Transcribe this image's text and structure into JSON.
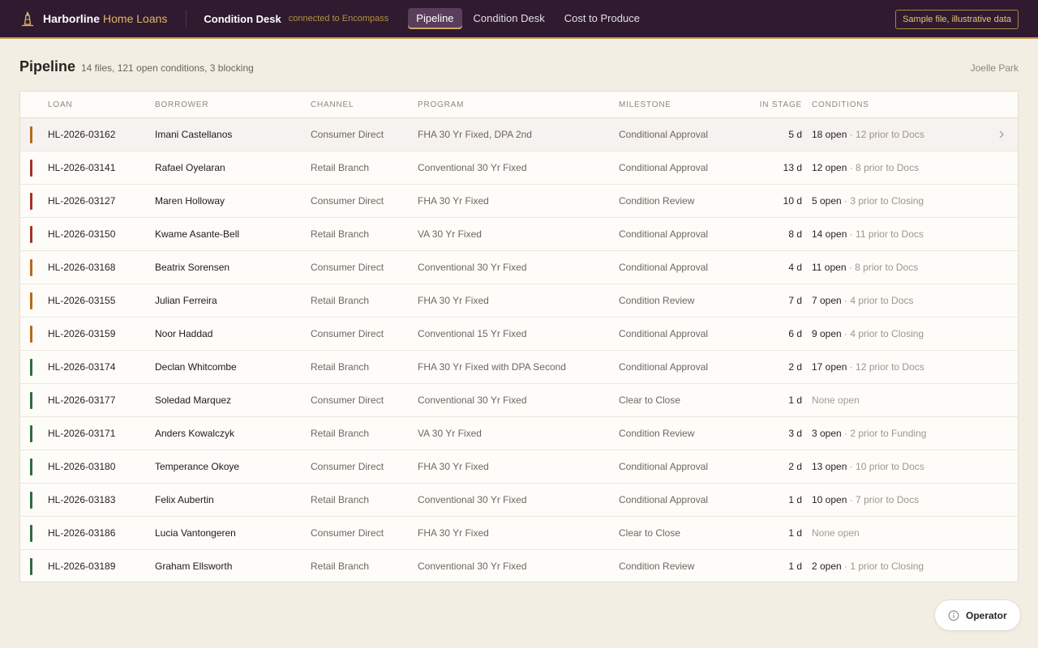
{
  "brand": {
    "name": "Harborline",
    "sub": "Home Loans",
    "icon": "lighthouse-icon"
  },
  "app": {
    "title": "Condition Desk",
    "status": "connected to Encompass"
  },
  "nav": {
    "tabs": [
      {
        "label": "Pipeline",
        "active": true
      },
      {
        "label": "Condition Desk",
        "active": false
      },
      {
        "label": "Cost to Produce",
        "active": false
      }
    ]
  },
  "badge": "Sample file, illustrative data",
  "page": {
    "title": "Pipeline",
    "summary": "14 files, 121 open conditions, 3 blocking",
    "user": "Joelle Park"
  },
  "table": {
    "headers": {
      "loan": "LOAN",
      "borrower": "BORROWER",
      "channel": "CHANNEL",
      "program": "PROGRAM",
      "milestone": "MILESTONE",
      "stage": "IN STAGE",
      "conditions": "CONDITIONS"
    },
    "rows": [
      {
        "status": "amber",
        "loan": "HL-2026-03162",
        "borrower": "Imani Castellanos",
        "channel": "Consumer Direct",
        "program": "FHA 30 Yr Fixed, DPA 2nd",
        "milestone": "Conditional Approval",
        "stage": "5 d",
        "cond_main": "18 open",
        "cond_sub": " · 12 prior to Docs"
      },
      {
        "status": "red",
        "loan": "HL-2026-03141",
        "borrower": "Rafael Oyelaran",
        "channel": "Retail Branch",
        "program": "Conventional 30 Yr Fixed",
        "milestone": "Conditional Approval",
        "stage": "13 d",
        "cond_main": "12 open",
        "cond_sub": " · 8 prior to Docs"
      },
      {
        "status": "red",
        "loan": "HL-2026-03127",
        "borrower": "Maren Holloway",
        "channel": "Consumer Direct",
        "program": "FHA 30 Yr Fixed",
        "milestone": "Condition Review",
        "stage": "10 d",
        "cond_main": "5 open",
        "cond_sub": " · 3 prior to Closing"
      },
      {
        "status": "red",
        "loan": "HL-2026-03150",
        "borrower": "Kwame Asante-Bell",
        "channel": "Retail Branch",
        "program": "VA 30 Yr Fixed",
        "milestone": "Conditional Approval",
        "stage": "8 d",
        "cond_main": "14 open",
        "cond_sub": " · 11 prior to Docs"
      },
      {
        "status": "amber",
        "loan": "HL-2026-03168",
        "borrower": "Beatrix Sorensen",
        "channel": "Consumer Direct",
        "program": "Conventional 30 Yr Fixed",
        "milestone": "Conditional Approval",
        "stage": "4 d",
        "cond_main": "11 open",
        "cond_sub": " · 8 prior to Docs"
      },
      {
        "status": "amber",
        "loan": "HL-2026-03155",
        "borrower": "Julian Ferreira",
        "channel": "Retail Branch",
        "program": "FHA 30 Yr Fixed",
        "milestone": "Condition Review",
        "stage": "7 d",
        "cond_main": "7 open",
        "cond_sub": " · 4 prior to Docs"
      },
      {
        "status": "amber",
        "loan": "HL-2026-03159",
        "borrower": "Noor Haddad",
        "channel": "Consumer Direct",
        "program": "Conventional 15 Yr Fixed",
        "milestone": "Conditional Approval",
        "stage": "6 d",
        "cond_main": "9 open",
        "cond_sub": " · 4 prior to Closing"
      },
      {
        "status": "green",
        "loan": "HL-2026-03174",
        "borrower": "Declan Whitcombe",
        "channel": "Retail Branch",
        "program": "FHA 30 Yr Fixed with DPA Second",
        "milestone": "Conditional Approval",
        "stage": "2 d",
        "cond_main": "17 open",
        "cond_sub": " · 12 prior to Docs"
      },
      {
        "status": "green",
        "loan": "HL-2026-03177",
        "borrower": "Soledad Marquez",
        "channel": "Consumer Direct",
        "program": "Conventional 30 Yr Fixed",
        "milestone": "Clear to Close",
        "stage": "1 d",
        "cond_main": "",
        "cond_sub": "",
        "cond_none": "None open"
      },
      {
        "status": "green",
        "loan": "HL-2026-03171",
        "borrower": "Anders Kowalczyk",
        "channel": "Retail Branch",
        "program": "VA 30 Yr Fixed",
        "milestone": "Condition Review",
        "stage": "3 d",
        "cond_main": "3 open",
        "cond_sub": " · 2 prior to Funding"
      },
      {
        "status": "green",
        "loan": "HL-2026-03180",
        "borrower": "Temperance Okoye",
        "channel": "Consumer Direct",
        "program": "FHA 30 Yr Fixed",
        "milestone": "Conditional Approval",
        "stage": "2 d",
        "cond_main": "13 open",
        "cond_sub": " · 10 prior to Docs"
      },
      {
        "status": "green",
        "loan": "HL-2026-03183",
        "borrower": "Felix Aubertin",
        "channel": "Retail Branch",
        "program": "Conventional 30 Yr Fixed",
        "milestone": "Conditional Approval",
        "stage": "1 d",
        "cond_main": "10 open",
        "cond_sub": " · 7 prior to Docs"
      },
      {
        "status": "green",
        "loan": "HL-2026-03186",
        "borrower": "Lucia Vantongeren",
        "channel": "Consumer Direct",
        "program": "FHA 30 Yr Fixed",
        "milestone": "Clear to Close",
        "stage": "1 d",
        "cond_main": "",
        "cond_sub": "",
        "cond_none": "None open"
      },
      {
        "status": "green",
        "loan": "HL-2026-03189",
        "borrower": "Graham Ellsworth",
        "channel": "Retail Branch",
        "program": "Conventional 30 Yr Fixed",
        "milestone": "Condition Review",
        "stage": "1 d",
        "cond_main": "2 open",
        "cond_sub": " · 1 prior to Closing"
      }
    ],
    "hover_row": 0
  },
  "status_colors": {
    "red": "#a3312c",
    "amber": "#b8681e",
    "green": "#2e6b3f"
  },
  "operator": {
    "label": "Operator",
    "icon": "info-icon"
  }
}
